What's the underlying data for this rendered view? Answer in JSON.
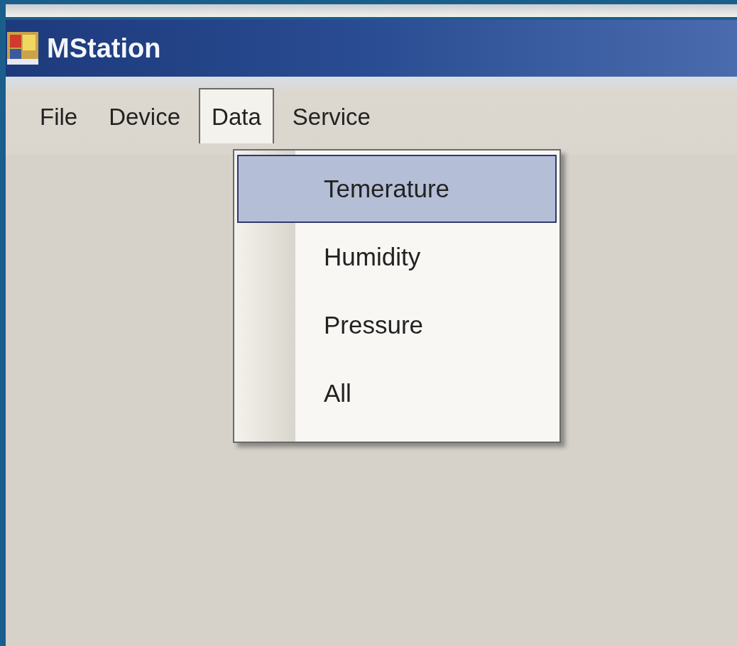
{
  "window": {
    "title": "MStation"
  },
  "menu_bar": [
    {
      "label": "File",
      "selected": false
    },
    {
      "label": "Device",
      "selected": false
    },
    {
      "label": "Data",
      "selected": true
    },
    {
      "label": "Service",
      "selected": false
    }
  ],
  "dropdown": [
    {
      "label": "Temerature",
      "selected": true
    },
    {
      "label": "Humidity",
      "selected": false
    },
    {
      "label": "Pressure",
      "selected": false
    },
    {
      "label": "All",
      "selected": false
    }
  ]
}
